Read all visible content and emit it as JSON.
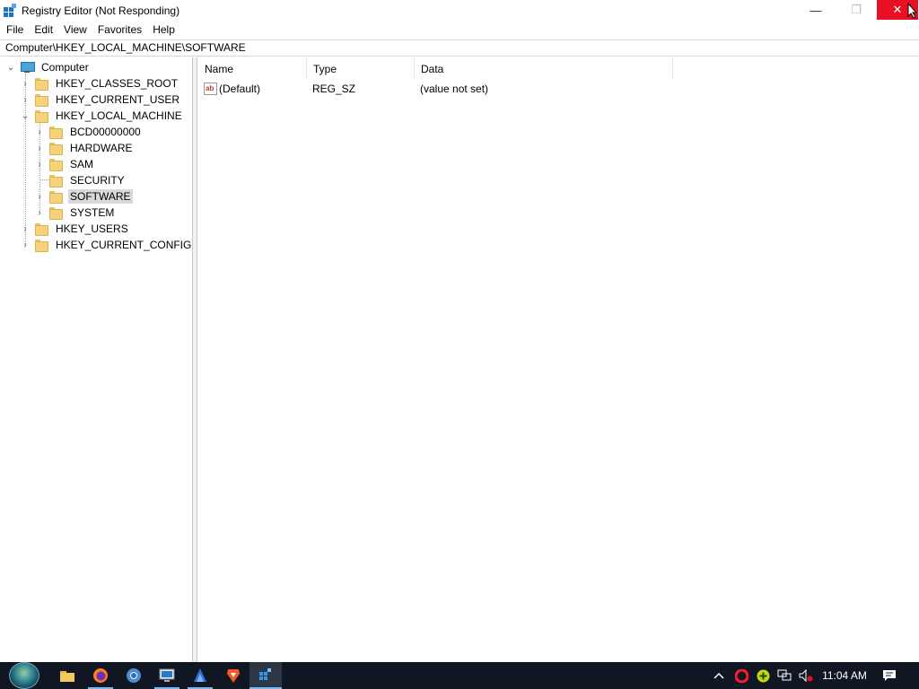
{
  "window": {
    "title": "Registry Editor (Not Responding)",
    "minimize": "—",
    "maximize": "❐",
    "close": "✕"
  },
  "menu": {
    "items": [
      "File",
      "Edit",
      "View",
      "Favorites",
      "Help"
    ]
  },
  "address": {
    "path": "Computer\\HKEY_LOCAL_MACHINE\\SOFTWARE"
  },
  "tree": {
    "root": "Computer",
    "hives": [
      "HKEY_CLASSES_ROOT",
      "HKEY_CURRENT_USER",
      "HKEY_LOCAL_MACHINE",
      "HKEY_USERS",
      "HKEY_CURRENT_CONFIG"
    ],
    "hklm_children": [
      "BCD00000000",
      "HARDWARE",
      "SAM",
      "SECURITY",
      "SOFTWARE",
      "SYSTEM"
    ],
    "selected": "SOFTWARE"
  },
  "list": {
    "columns": [
      "Name",
      "Type",
      "Data"
    ],
    "rows": [
      {
        "name": "(Default)",
        "type": "REG_SZ",
        "data": "(value not set)",
        "icon": "reg-sz-icon"
      }
    ]
  },
  "taskbar": {
    "apps": [
      {
        "name": "file-explorer",
        "icon": "📁",
        "active": false
      },
      {
        "name": "firefox",
        "icon": "🦊",
        "active": false,
        "running": true
      },
      {
        "name": "chrome",
        "icon": "◉",
        "active": false
      },
      {
        "name": "remote-desktop",
        "icon": "🖥",
        "active": false,
        "running": true
      },
      {
        "name": "vpn-app",
        "icon": "▲",
        "active": false,
        "running": true
      },
      {
        "name": "brave",
        "icon": "🦁",
        "active": false
      },
      {
        "name": "registry-editor",
        "icon": "▦",
        "active": true
      }
    ],
    "clock": "11:04 AM",
    "tray": {
      "chevron": "^",
      "opera": "O",
      "plus": "+",
      "network": "🖧",
      "volume": "🔇",
      "notification": "🗨"
    }
  },
  "colors": {
    "close_button": "#e81123",
    "taskbar": "#101723",
    "folder": "#f6d27a",
    "selection": "#d9d9d9"
  }
}
